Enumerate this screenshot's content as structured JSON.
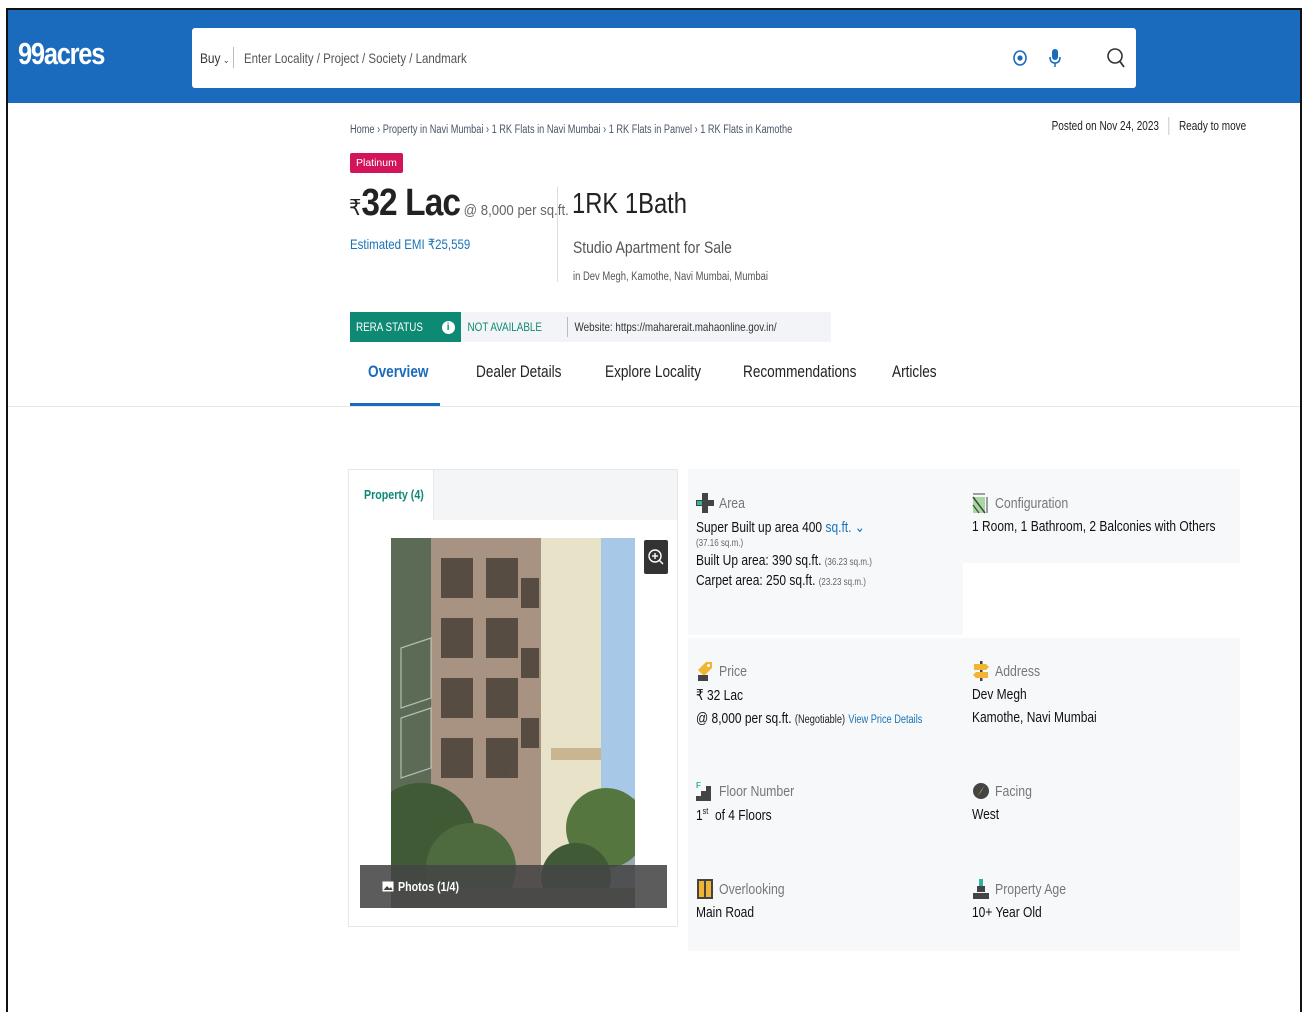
{
  "header": {
    "logo": "99acres",
    "buy_label": "Buy",
    "search_placeholder": "Enter Locality / Project / Society / Landmark"
  },
  "breadcrumb": "Home › Property in Navi Mumbai › 1 RK Flats in Navi Mumbai › 1 RK Flats in Panvel › 1 RK Flats in Kamothe",
  "posted": "Posted on Nov 24, 2023",
  "ready": "Ready to move",
  "badge": "Platinum",
  "price": {
    "symbol": "₹",
    "amount": "32 Lac",
    "per_sqft": "@ 8,000 per sq.ft.",
    "emi": "Estimated EMI ₹25,559"
  },
  "config": {
    "title": "1RK 1Bath",
    "subtitle": "Studio Apartment for Sale",
    "location": "in Dev Megh, Kamothe, Navi Mumbai, Mumbai"
  },
  "rera": {
    "status_label": "RERA STATUS",
    "info_icon": "i",
    "value": "NOT AVAILABLE",
    "website": "Website: https://maharerait.mahaonline.gov.in/"
  },
  "tabs": [
    "Overview",
    "Dealer Details",
    "Explore Locality",
    "Recommendations",
    "Articles"
  ],
  "photo_card": {
    "tab": "Property (4)",
    "photos": "Photos (1/4)"
  },
  "details": {
    "area": {
      "label": "Area",
      "super_built": "Super Built up area 400",
      "unit": "sq.ft.",
      "super_built_sqm": "(37.16 sq.m.)",
      "built_up": "Built Up area: 390 sq.ft.",
      "built_up_sqm": "(36.23 sq.m.)",
      "carpet": "Carpet area: 250 sq.ft.",
      "carpet_sqm": "(23.23 sq.m.)"
    },
    "configuration": {
      "label": "Configuration",
      "value": "1 Room, 1 Bathroom, 2 Balconies with Others"
    },
    "price": {
      "label": "Price",
      "value": "₹ 32 Lac",
      "per_sqft": "@ 8,000 per sq.ft.",
      "negotiable": "(Negotiable)",
      "link": "View Price Details"
    },
    "address": {
      "label": "Address",
      "line1": "Dev Megh",
      "line2": "Kamothe, Navi Mumbai"
    },
    "floor": {
      "label": "Floor Number",
      "ordinal": "1",
      "sup": "st",
      "rest": "of 4 Floors"
    },
    "facing": {
      "label": "Facing",
      "value": "West"
    },
    "overlooking": {
      "label": "Overlooking",
      "value": "Main Road"
    },
    "age": {
      "label": "Property Age",
      "value": "10+ Year Old"
    }
  },
  "colors": {
    "brand": "#1a6bbd",
    "platinum": "#d4145a",
    "rera": "#0e8a74",
    "link": "#1a73b8"
  }
}
